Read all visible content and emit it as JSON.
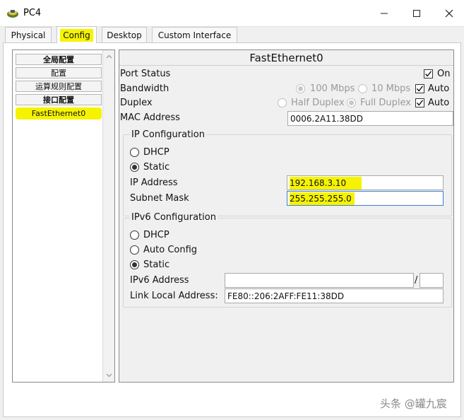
{
  "window": {
    "title": "PC4",
    "icon": "pc-icon"
  },
  "tabs": [
    {
      "label": "Physical"
    },
    {
      "label": "Config"
    },
    {
      "label": "Desktop"
    },
    {
      "label": "Custom Interface"
    }
  ],
  "sidebar": {
    "items": [
      {
        "label": "全局配置"
      },
      {
        "label": "配置"
      },
      {
        "label": "运算规则配置"
      },
      {
        "label": "接口配置"
      },
      {
        "label": "FastEthernet0"
      }
    ]
  },
  "interface": {
    "title": "FastEthernet0",
    "port_status": {
      "label": "Port Status",
      "on_label": "On",
      "on_checked": true
    },
    "bandwidth": {
      "label": "Bandwidth",
      "option_100": "100 Mbps",
      "option_10": "10 Mbps",
      "auto_label": "Auto",
      "auto_checked": true
    },
    "duplex": {
      "label": "Duplex",
      "option_half": "Half Duplex",
      "option_full": "Full Duplex",
      "auto_label": "Auto",
      "auto_checked": true
    },
    "mac": {
      "label": "MAC Address",
      "value": "0006.2A11.38DD"
    }
  },
  "ip_config": {
    "title": "IP Configuration",
    "dhcp_label": "DHCP",
    "static_label": "Static",
    "selected": "Static",
    "ip_label": "IP Address",
    "ip_value": "192.168.3.10",
    "mask_label": "Subnet Mask",
    "mask_value": "255.255.255.0"
  },
  "ipv6_config": {
    "title": "IPv6 Configuration",
    "dhcp_label": "DHCP",
    "auto_label": "Auto Config",
    "static_label": "Static",
    "selected": "Static",
    "address_label": "IPv6 Address",
    "address_value": "",
    "separator": "/",
    "prefix_value": "",
    "link_local_label": "Link Local Address:",
    "link_local_value": "FE80::206:2AFF:FE11:38DD"
  },
  "watermark": "头条 @罐九宸",
  "colors": {
    "highlight": "#f5f300",
    "window_bg": "#f0f0f0",
    "focus_border": "#3c7fd0"
  }
}
